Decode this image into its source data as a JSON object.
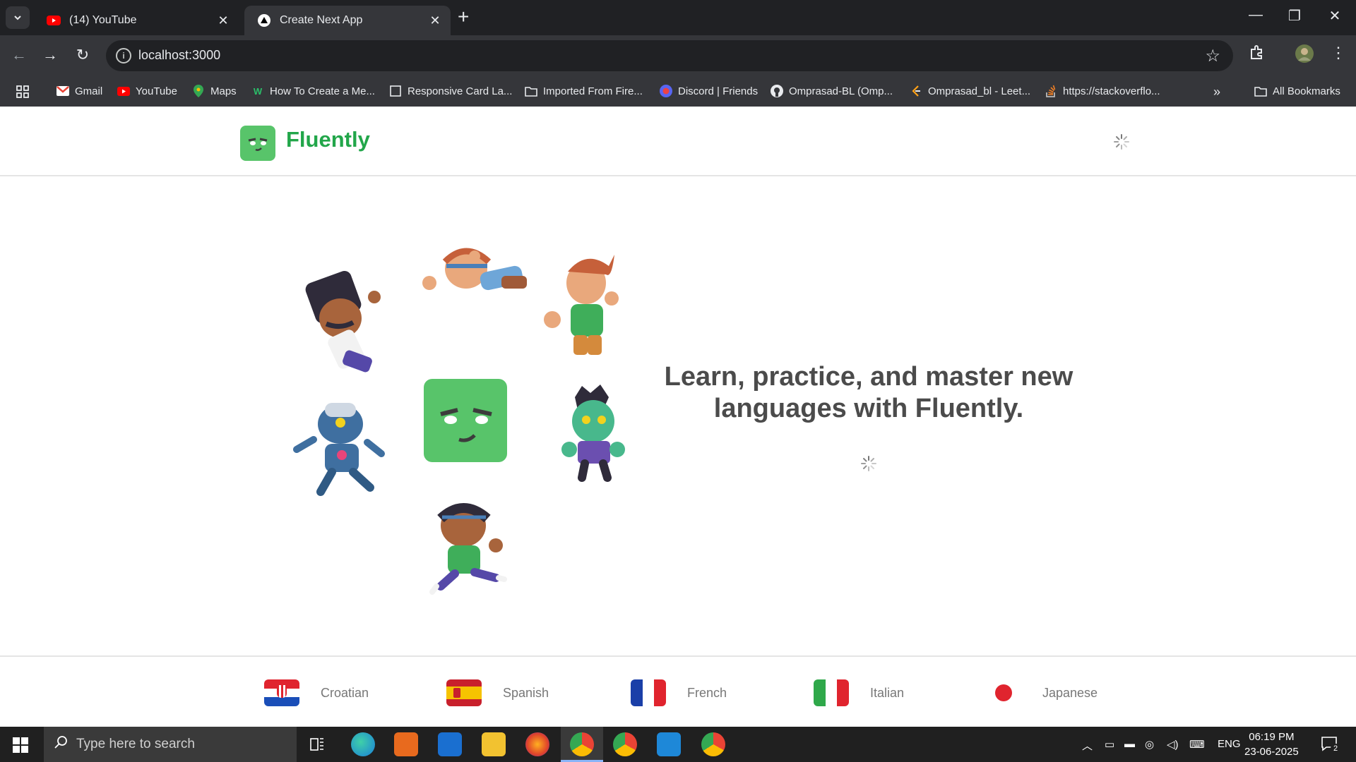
{
  "browser": {
    "tabs": [
      {
        "label": "(14) YouTube",
        "active": false
      },
      {
        "label": "Create Next App",
        "active": true
      }
    ],
    "url": "localhost:3000",
    "bookmarks": [
      {
        "label": "Gmail",
        "icon": "gmail-icon"
      },
      {
        "label": "YouTube",
        "icon": "youtube-icon"
      },
      {
        "label": "Maps",
        "icon": "maps-icon"
      },
      {
        "label": "How To Create a Me...",
        "icon": "webflow-icon"
      },
      {
        "label": "Responsive Card La...",
        "icon": "page-icon"
      },
      {
        "label": "Imported From Fire...",
        "icon": "folder-icon"
      },
      {
        "label": "Discord | Friends",
        "icon": "discord-icon"
      },
      {
        "label": "Omprasad-BL (Omp...",
        "icon": "github-icon"
      },
      {
        "label": "Omprasad_bl - Leet...",
        "icon": "leetcode-icon"
      },
      {
        "label": "https://stackoverflo...",
        "icon": "stackoverflow-icon"
      }
    ],
    "all_bookmarks_label": "All Bookmarks"
  },
  "app": {
    "brand": "Fluently",
    "hero_title": "Learn, practice, and master new languages with Fluently.",
    "accent_color": "#22a64a",
    "languages": [
      {
        "name": "Croatian",
        "flag": "croatia-flag"
      },
      {
        "name": "Spanish",
        "flag": "spain-flag"
      },
      {
        "name": "French",
        "flag": "france-flag"
      },
      {
        "name": "Italian",
        "flag": "italy-flag"
      },
      {
        "name": "Japanese",
        "flag": "japan-flag"
      }
    ]
  },
  "taskbar": {
    "search_placeholder": "Type here to search",
    "language": "ENG",
    "time": "06:19 PM",
    "date": "23-06-2025",
    "notification_count": "2"
  }
}
